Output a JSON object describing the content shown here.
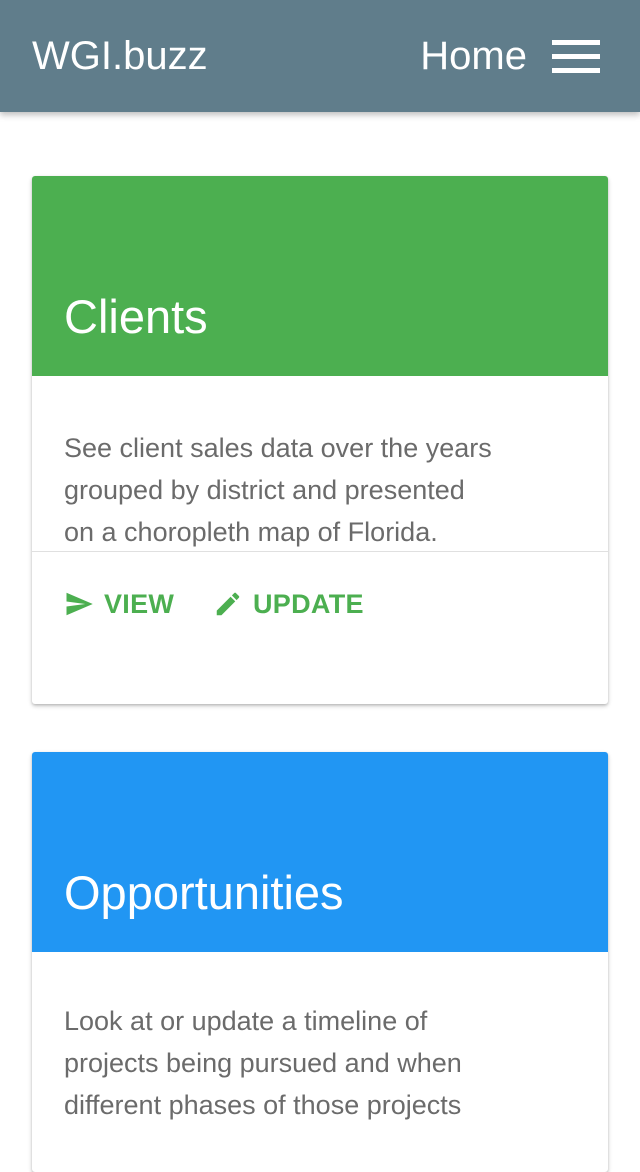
{
  "navbar": {
    "brand": "WGI.buzz",
    "home_label": "Home",
    "menu_icon": "hamburger-menu-icon",
    "bg_color": "#607d8b"
  },
  "cards": [
    {
      "title": "Clients",
      "header_color": "#4caf50",
      "body_lines": [
        "See client sales data over the years",
        "grouped by district and presented",
        "on a choropleth map of Florida."
      ],
      "actions": [
        {
          "label": "VIEW",
          "icon": "send-icon"
        },
        {
          "label": "UPDATE",
          "icon": "pencil-icon"
        }
      ],
      "action_color": "#4caf50"
    },
    {
      "title": "Opportunities",
      "header_color": "#2196f3",
      "body_lines": [
        "Look at or update a timeline of",
        "projects being pursued and when",
        "different phases of those projects"
      ]
    }
  ]
}
